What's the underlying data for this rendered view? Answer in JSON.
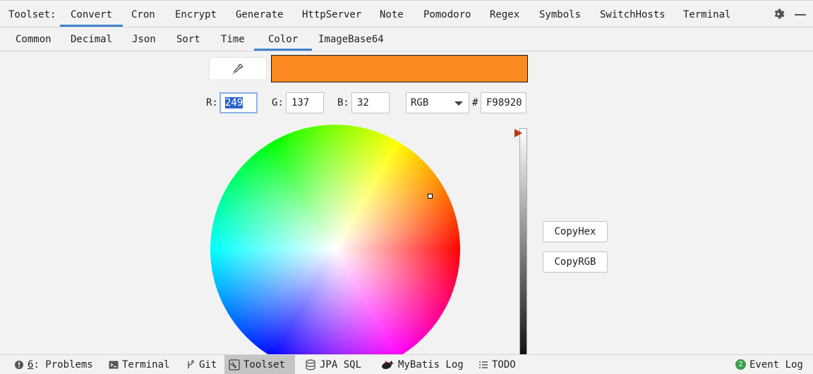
{
  "toolbar": {
    "label": "Toolset:",
    "tabs": [
      "Convert",
      "Cron",
      "Encrypt",
      "Generate",
      "HttpServer",
      "Note",
      "Pomodoro",
      "Regex",
      "Symbols",
      "SwitchHosts",
      "Terminal"
    ],
    "active_tab": "Convert",
    "icons": [
      "gear-icon",
      "minimize-icon"
    ]
  },
  "subtabs": {
    "items": [
      "Common",
      "Decimal",
      "Json",
      "Sort",
      "Time",
      "Color",
      "ImageBase64"
    ],
    "active": "Color"
  },
  "color": {
    "picker_icon": "eyedropper-icon",
    "swatch_color": "#F98920",
    "r_label": "R:",
    "r_value": "249",
    "g_label": "G:",
    "g_value": "137",
    "b_label": "B:",
    "b_value": "32",
    "mode": "RGB",
    "hash": "#",
    "hex": "F98920",
    "copy_hex": "CopyHex",
    "copy_rgb": "CopyRGB"
  },
  "statusbar": {
    "problems_num": "6",
    "problems_rest": ": Problems",
    "terminal": "Terminal",
    "git": "Git",
    "toolset": "Toolset",
    "jpa": "JPA SQL",
    "mybatis": "MyBatis Log",
    "todo": "TODO",
    "event_count": "2",
    "event_log": "Event Log"
  },
  "colors": {
    "accent": "#4083c9",
    "selection": "#2f65ca",
    "slider_thumb": "#b53d12",
    "event_badge": "#3a9e4e"
  }
}
